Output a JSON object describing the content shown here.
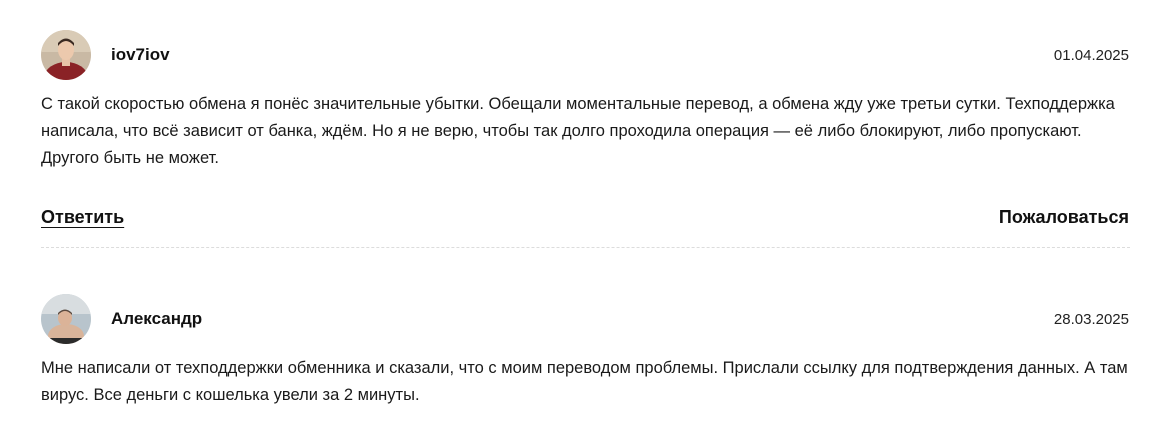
{
  "comments": [
    {
      "author": "iov7iov",
      "date": "01.04.2025",
      "text": "С такой скоростью обмена я понёс значительные убытки. Обещали моментальные перевод, а обмена жду уже третьи сутки. Техподдержка написала, что всё зависит от банка, ждём. Но я не верю, чтобы так долго проходила операция — её либо блокируют, либо пропускают. Другого быть не может.",
      "reply_label": "Ответить",
      "report_label": "Пожаловаться"
    },
    {
      "author": "Александр",
      "date": "28.03.2025",
      "text": "Мне написали от техподдержки обменника и сказали, что с моим переводом проблемы. Прислали ссылку для подтверждения данных. А там вирус. Все деньги с кошелька увели за 2 минуты."
    }
  ]
}
